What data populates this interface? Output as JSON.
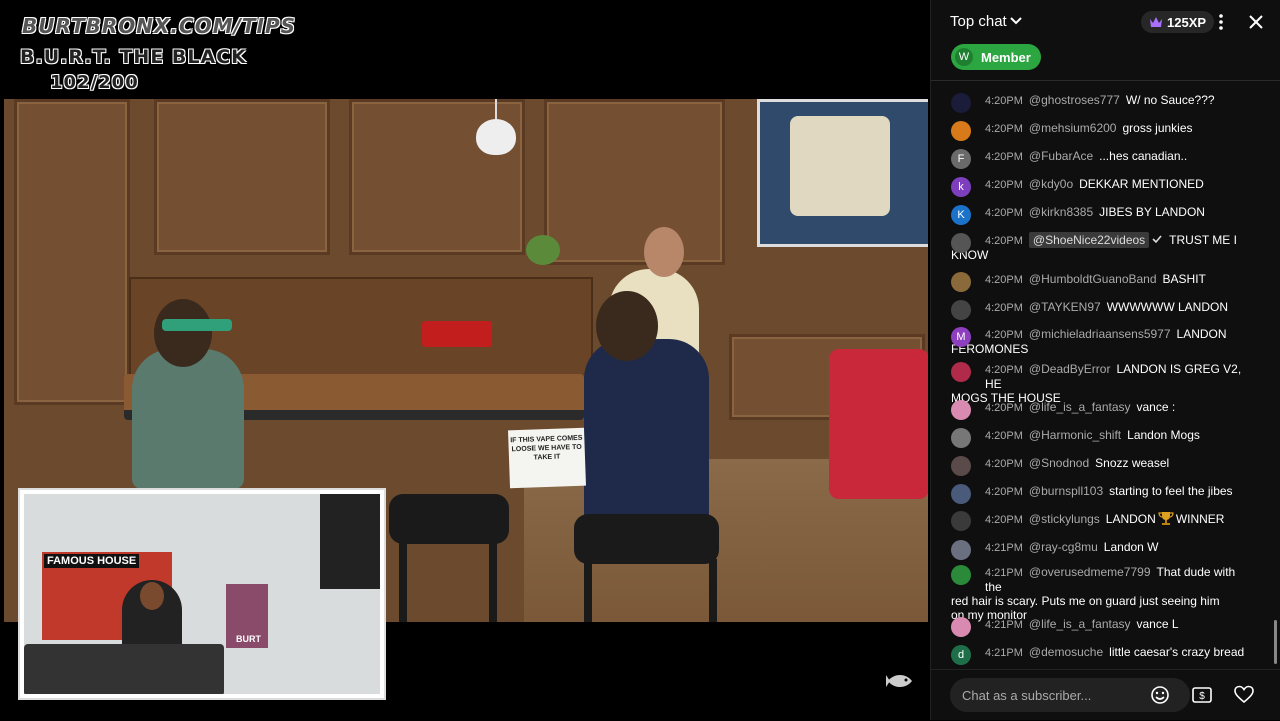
{
  "overlay": {
    "site": "BURTBRONX.COM/TIPS",
    "name": "B.U.R.T. THE BLACK",
    "count": "102/200"
  },
  "scene": {
    "sign_text": "IF THIS VAPE COMES LOOSE WE HAVE TO TAKE IT"
  },
  "webcam": {
    "poster_title": "FAMOUS HOUSE",
    "burt_label": "BURT"
  },
  "chat": {
    "title": "Top chat",
    "xp": "125XP",
    "filter_chip": {
      "initial": "W",
      "label": "Member"
    },
    "input_placeholder": "Chat as a subscriber...",
    "colors": {
      "member_chip": "#2ba640",
      "background": "#0f0f0f"
    },
    "messages": [
      {
        "time": "4:20PM",
        "author": "@ghostroses777",
        "text": "W/ no Sauce???",
        "avatar_color": "#1b1b3a"
      },
      {
        "time": "4:20PM",
        "author": "@mehsium6200",
        "text": "gross junkies",
        "avatar_color": "#d97a1a"
      },
      {
        "time": "4:20PM",
        "author": "@FubarAce",
        "text": "...hes canadian..",
        "avatar_initial": "F",
        "avatar_color": "#6a6a6a"
      },
      {
        "time": "4:20PM",
        "author": "@kdy0o",
        "text": "DEKKAR MENTIONED",
        "avatar_initial": "k",
        "avatar_color": "#7e3fbf"
      },
      {
        "time": "4:20PM",
        "author": "@kirkn8385",
        "text": "JIBES BY LANDON",
        "avatar_initial": "K",
        "avatar_color": "#1a73c9"
      },
      {
        "time": "4:20PM",
        "author": "@ShoeNice22videos",
        "text": "TRUST ME I",
        "cont": "KNOW",
        "member": true,
        "avatar_color": "#555555"
      },
      {
        "time": "4:20PM",
        "author": "@HumboldtGuanoBand",
        "text": "BASHIT",
        "avatar_color": "#8a6a3a"
      },
      {
        "time": "4:20PM",
        "author": "@TAYKEN97",
        "text": "WWWWWW LANDON",
        "avatar_color": "#444444"
      },
      {
        "time": "4:20PM",
        "author": "@michieladriaansens5977",
        "text": "LANDON",
        "cont": "FEROMONES",
        "avatar_initial": "M",
        "avatar_color": "#8e3fbf"
      },
      {
        "time": "4:20PM",
        "author": "@DeadByError",
        "text": "LANDON IS GREG V2, HE",
        "cont": "MOGS THE HOUSE",
        "avatar_color": "#b02a4a"
      },
      {
        "time": "4:20PM",
        "author": "@life_is_a_fantasy",
        "text": "vance :",
        "avatar_color": "#d98ab0"
      },
      {
        "time": "4:20PM",
        "author": "@Harmonic_shift",
        "text": "Landon Mogs",
        "avatar_color": "#777777"
      },
      {
        "time": "4:20PM",
        "author": "@Snodnod",
        "text": "Snozz weasel",
        "avatar_color": "#5a4a4a"
      },
      {
        "time": "4:20PM",
        "author": "@burnspll103",
        "text": "starting to feel the jibes",
        "avatar_color": "#4a5a7a"
      },
      {
        "time": "4:20PM",
        "author": "@stickylungs",
        "text": "LANDON",
        "text_after": "WINNER",
        "trophy": true,
        "avatar_color": "#3a3a3a"
      },
      {
        "time": "4:21PM",
        "author": "@ray-cg8mu",
        "text": "Landon W",
        "avatar_color": "#6a7080"
      },
      {
        "time": "4:21PM",
        "author": "@overusedmeme7799",
        "text": "That dude with the",
        "cont": "red hair is scary. Puts me on guard just seeing him",
        "cont2": "on my monitor",
        "avatar_color": "#2a8a3a"
      },
      {
        "time": "4:21PM",
        "author": "@life_is_a_fantasy",
        "text": "vance L",
        "avatar_color": "#d98ab0"
      },
      {
        "time": "4:21PM",
        "author": "@demosuche",
        "text": "little caesar's crazy bread",
        "avatar_initial": "d",
        "avatar_color": "#1f6e4a"
      }
    ]
  }
}
